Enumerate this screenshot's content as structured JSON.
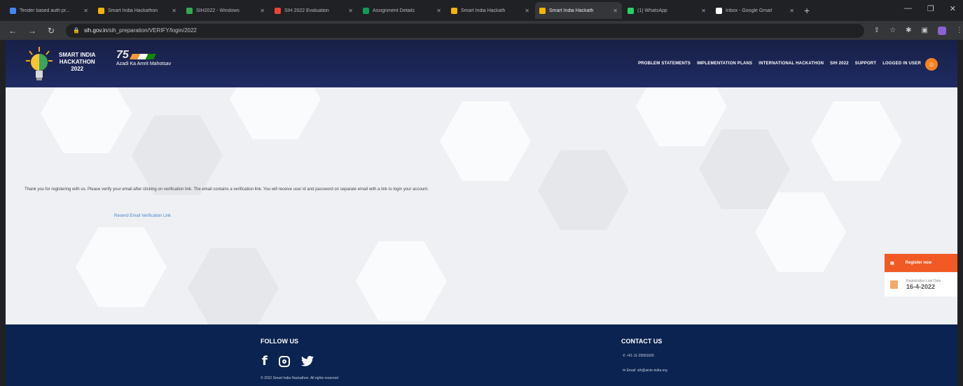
{
  "browser": {
    "tabs": [
      {
        "title": "Tender based auth pr...",
        "color": "#4285f4",
        "active": false
      },
      {
        "title": "Smart India Hackathon",
        "color": "#f4b400",
        "active": false
      },
      {
        "title": "SIH2022 - Windows",
        "color": "#34a853",
        "active": false
      },
      {
        "title": "SIH 2022 Evaluation",
        "color": "#ea4335",
        "active": false
      },
      {
        "title": "Assignment Details",
        "color": "#0f9d58",
        "active": false
      },
      {
        "title": "Smart India Hackath",
        "color": "#f4b400",
        "active": false
      },
      {
        "title": "Smart India Hackath",
        "color": "#f4b400",
        "active": true
      },
      {
        "title": "(1) WhatsApp",
        "color": "#25d366",
        "active": false
      },
      {
        "title": "Inbox - Google Gmail",
        "color": "#ffffff",
        "active": false
      }
    ],
    "url_host": "sih.gov.in",
    "url_path": "/sih_preparation/VERIFY/login/2022"
  },
  "header": {
    "logo_line1": "SMART INDIA",
    "logo_line2": "HACKATHON",
    "logo_line3": "2022",
    "azadi_line1": "75",
    "azadi_line2": "Azadi Ka Amrit Mahotsav",
    "nav": [
      "PROBLEM STATEMENTS",
      "IMPLEMENTATION PLANS",
      "INTERNATIONAL HACKATHON",
      "SIH 2022",
      "SUPPORT",
      "LOGGED IN USER"
    ]
  },
  "main": {
    "message": "Thank you for registering with us. Please verify your email after clicking on verification link. The email contains a verification link. You will receive user id and password on separate email with a link to login your account.",
    "resend_link": "Resend Email Verification Link",
    "register_button": "Register now",
    "last_date_label": "Registration Last Date",
    "last_date": "16-4-2022"
  },
  "footer": {
    "follow_title": "FOLLOW US",
    "copyright": "© 2022 Smart India Hackathon. All rights reserved",
    "contact_title": "CONTACT US",
    "phone": "+91-11-29581000",
    "email": "Email: sih@aicte-india.org"
  },
  "colors": {
    "header_bg": "#1f2b63",
    "footer_bg": "#0b2350",
    "accent": "#f15a24",
    "link": "#4a86c8"
  }
}
